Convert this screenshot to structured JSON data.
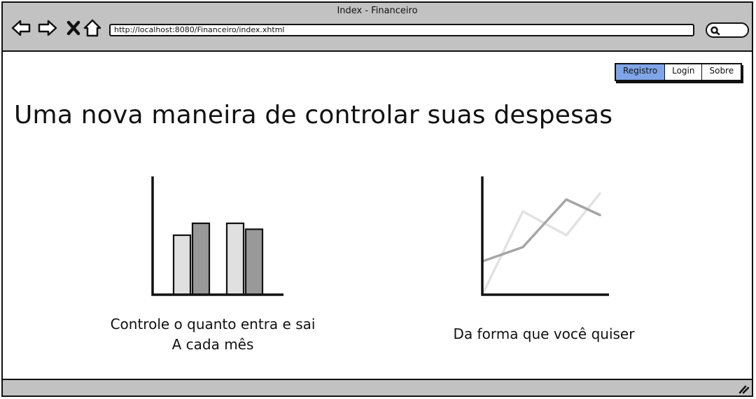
{
  "window": {
    "title": "Index - Financeiro"
  },
  "toolbar": {
    "url": "http://localhost:8080/Financeiro/index.xhtml",
    "icons": [
      "back-arrow-icon",
      "forward-arrow-icon",
      "close-x-icon",
      "home-icon",
      "search-icon"
    ]
  },
  "nav": {
    "tabs": [
      {
        "label": "Registro",
        "active": true
      },
      {
        "label": "Login",
        "active": false
      },
      {
        "label": "Sobre",
        "active": false
      }
    ]
  },
  "main": {
    "headline": "Uma nova maneira de controlar suas despesas",
    "features": [
      {
        "line1": "Controle o quanto entra e sai",
        "line2": "A cada mês"
      },
      {
        "line1": "Da forma que você quiser"
      }
    ]
  },
  "colors": {
    "chrome": "#c2c2c2",
    "active_tab": "#7fa5e8",
    "light_bar": "#e0e0e0",
    "dark_bar": "#999999"
  },
  "chart_data": [
    {
      "type": "bar",
      "series": [
        {
          "values": [
            5,
            6
          ]
        },
        {
          "values": [
            6,
            5.5
          ]
        }
      ],
      "ylim": [
        0,
        10
      ]
    },
    {
      "type": "line",
      "series": [
        {
          "values": [
            0,
            7,
            5,
            8.5
          ]
        },
        {
          "values": [
            2.8,
            4,
            8,
            6.7
          ]
        }
      ],
      "ylim": [
        0,
        10
      ]
    }
  ]
}
